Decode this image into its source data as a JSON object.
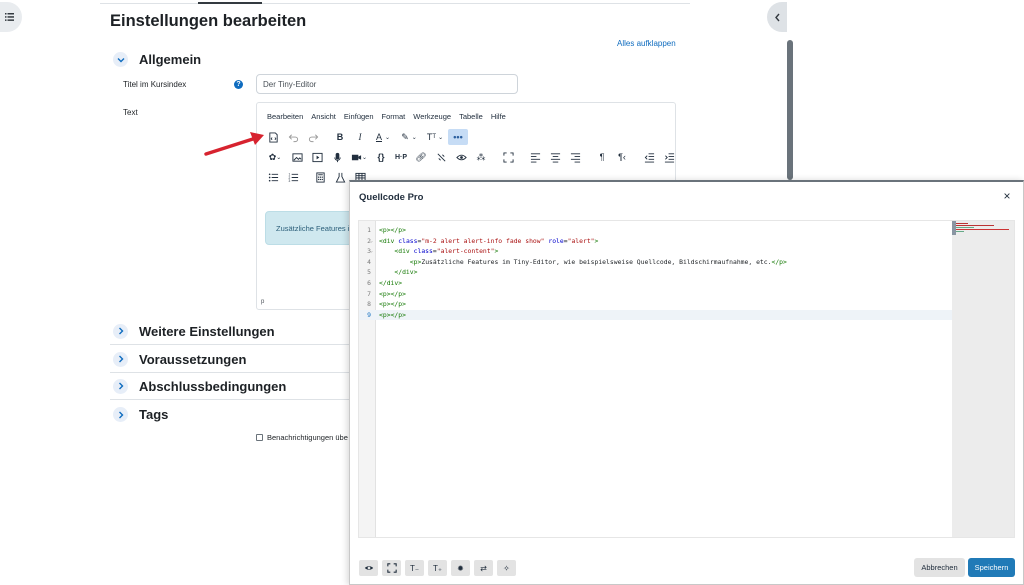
{
  "page": {
    "title": "Einstellungen bearbeiten",
    "expand_all": "Alles aufklappen"
  },
  "sections": [
    {
      "title": "Allgemein",
      "expanded": true
    },
    {
      "title": "Weitere Einstellungen",
      "expanded": false
    },
    {
      "title": "Voraussetzungen",
      "expanded": false
    },
    {
      "title": "Abschlussbedingungen",
      "expanded": false
    },
    {
      "title": "Tags",
      "expanded": false
    }
  ],
  "form": {
    "title_label": "Titel im Kursindex",
    "title_value": "Der Tiny-Editor",
    "text_label": "Text",
    "notify_label": "Benachrichtigungen übe"
  },
  "editor": {
    "menus": [
      "Bearbeiten",
      "Ansicht",
      "Einfügen",
      "Format",
      "Werkzeuge",
      "Tabelle",
      "Hilfe"
    ],
    "more_label": "•••",
    "alert_text": "Zusätzliche Features im",
    "status": "p"
  },
  "modal": {
    "title": "Quellcode Pro",
    "close": "×",
    "cancel": "Abbrechen",
    "save": "Speichern",
    "code_lines": [
      "<p></p>",
      "<div class=\"m-2 alert alert-info fade show\" role=\"alert\">",
      "    <div class=\"alert-content\">",
      "        <p>Zusätzliche Features im Tiny-Editor, wie beispielsweise Quellcode, Bildschirmaufnahme, etc.</p>",
      "    </div>",
      "</div>",
      "<p></p>",
      "<p></p>",
      "<p></p>"
    ],
    "active_line": 9
  },
  "colors": {
    "accent": "#0f6cbf",
    "primary_button": "#207ab7",
    "arrow": "#d7232f",
    "alert_bg": "#cfe8ef"
  }
}
